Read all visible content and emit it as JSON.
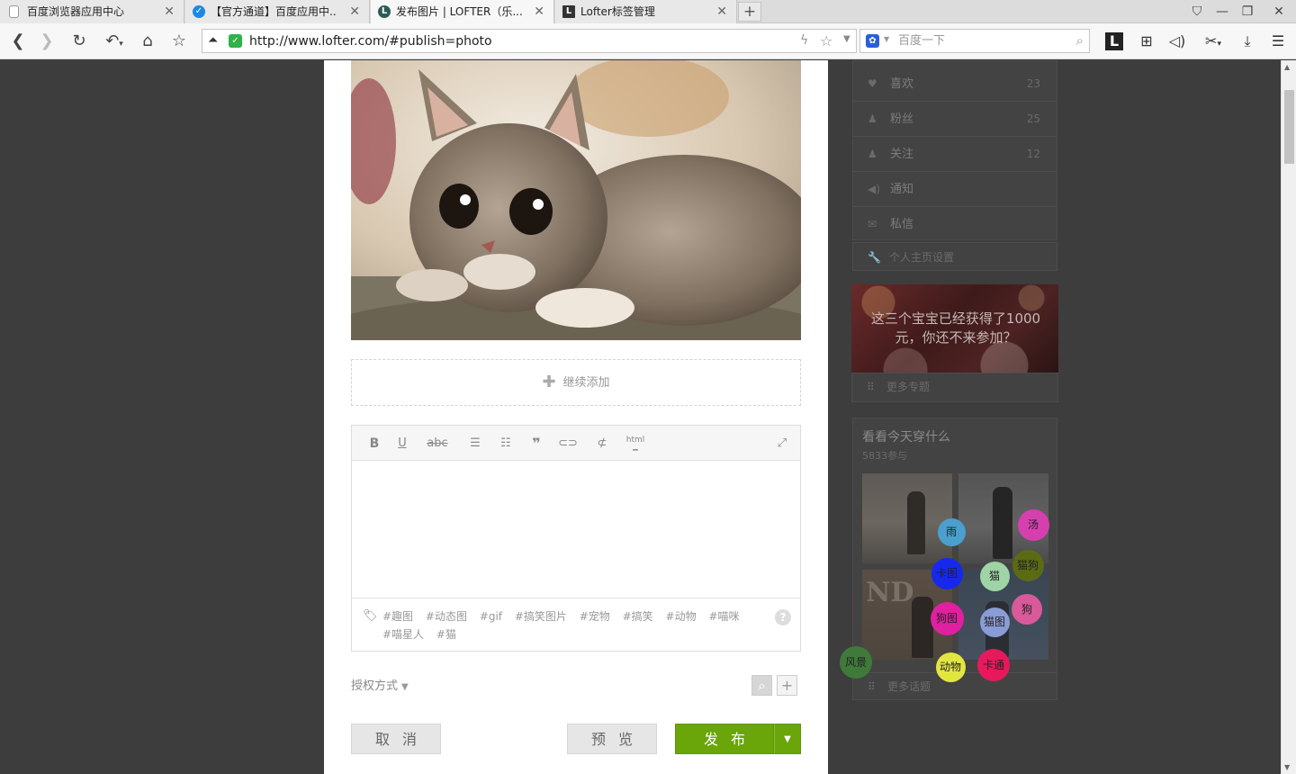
{
  "tabs": [
    {
      "label": "百度浏览器应用中心",
      "icon": "page-icon"
    },
    {
      "label": "【官方通道】百度应用中...",
      "icon": "baidu-app-icon"
    },
    {
      "label": "发布图片 | LOFTER（乐...",
      "icon": "lofter-icon"
    },
    {
      "label": "Lofter标签管理",
      "icon": "lofter-logo-icon"
    }
  ],
  "address": {
    "url": "http://www.lofter.com/#publish=photo"
  },
  "search": {
    "placeholder": "百度一下"
  },
  "editor": {
    "add_more": "继续添加",
    "tags": [
      "#趣图",
      "#动态图",
      "#gif",
      "#搞笑图片",
      "#宠物",
      "#搞笑",
      "#动物",
      "#喵咪",
      "#喵星人",
      "#猫"
    ],
    "help": "?",
    "license": "授权方式"
  },
  "actions": {
    "cancel": "取消",
    "preview": "预览",
    "publish": "发布"
  },
  "sidebar": {
    "stats": [
      {
        "label": "喜欢",
        "count": "23",
        "icon": "heart-icon"
      },
      {
        "label": "粉丝",
        "count": "25",
        "icon": "user-icon"
      },
      {
        "label": "关注",
        "count": "12",
        "icon": "user-icon"
      },
      {
        "label": "通知",
        "count": "",
        "icon": "speaker-icon"
      },
      {
        "label": "私信",
        "count": "",
        "icon": "mail-icon"
      }
    ],
    "profile_settings": "个人主页设置",
    "banner_text": "这三个宝宝已经获得了1000元，你还不来参加？",
    "more_topics": "更多专题",
    "wear_title": "看看今天穿什么",
    "wear_count": "5833参与",
    "more_topics_2": "更多话题"
  },
  "bubbles": [
    {
      "label": "雨",
      "color": "#4a9fcf"
    },
    {
      "label": "汤",
      "color": "#d63fae"
    },
    {
      "label": "卡图",
      "color": "#1628ee"
    },
    {
      "label": "猫",
      "color": "#9fd4a6"
    },
    {
      "label": "猫狗",
      "color": "#5b6b14"
    },
    {
      "label": "狗",
      "color": "#d85a9a"
    },
    {
      "label": "狗图",
      "color": "#e020a0"
    },
    {
      "label": "猫图",
      "color": "#8a9cd6"
    },
    {
      "label": "风景",
      "color": "#3f7a3a"
    },
    {
      "label": "动物",
      "color": "#e3e640"
    },
    {
      "label": "卡通",
      "color": "#e8185c"
    }
  ]
}
